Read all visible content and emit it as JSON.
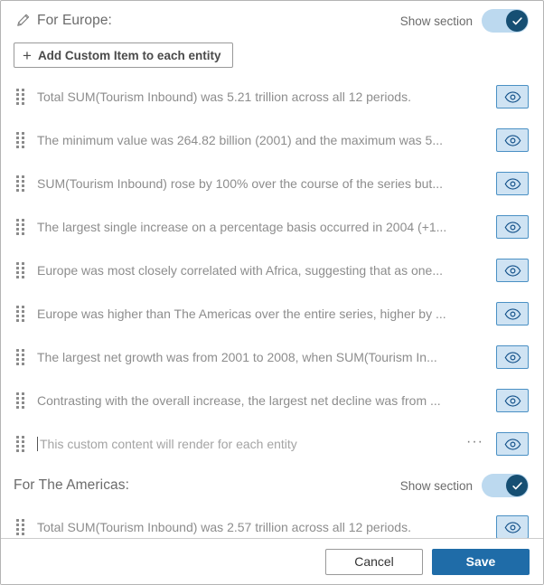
{
  "dialog": {
    "sections": [
      {
        "title": "For Europe:",
        "has_edit_icon": true,
        "edit_icon": "pencil-icon",
        "show_section_label": "Show section",
        "toggle_on": true,
        "add_button_label": "Add Custom Item to each entity",
        "add_button_icon": "plus-icon",
        "items": [
          {
            "text": "Total SUM(Tourism Inbound) was 5.21 trillion across all 12 periods.",
            "placeholder": false,
            "has_menu": false,
            "visibility_icon": "eye-icon"
          },
          {
            "text": "The minimum value was 264.82 billion (2001) and the maximum was 5...",
            "placeholder": false,
            "has_menu": false,
            "visibility_icon": "eye-icon"
          },
          {
            "text": "SUM(Tourism Inbound) rose by 100% over the course of the series but...",
            "placeholder": false,
            "has_menu": false,
            "visibility_icon": "eye-icon"
          },
          {
            "text": "The largest single increase on a percentage basis occurred in 2004 (+1...",
            "placeholder": false,
            "has_menu": false,
            "visibility_icon": "eye-icon"
          },
          {
            "text": "Europe was most closely correlated with Africa, suggesting that as one...",
            "placeholder": false,
            "has_menu": false,
            "visibility_icon": "eye-icon"
          },
          {
            "text": "Europe was higher than The Americas over the entire series, higher by ...",
            "placeholder": false,
            "has_menu": false,
            "visibility_icon": "eye-icon"
          },
          {
            "text": "The largest net growth was from 2001 to 2008, when SUM(Tourism In...",
            "placeholder": false,
            "has_menu": false,
            "visibility_icon": "eye-icon"
          },
          {
            "text": "Contrasting with the overall increase, the largest net decline was from ...",
            "placeholder": false,
            "has_menu": false,
            "visibility_icon": "eye-icon"
          },
          {
            "text": "This custom content will render for each entity",
            "placeholder": true,
            "has_menu": true,
            "menu_label": "···",
            "visibility_icon": "eye-icon"
          }
        ]
      },
      {
        "title": "For The Americas:",
        "has_edit_icon": false,
        "show_section_label": "Show section",
        "toggle_on": true,
        "items": [
          {
            "text": "Total SUM(Tourism Inbound) was 2.57 trillion across all 12 periods.",
            "placeholder": false,
            "has_menu": false,
            "visibility_icon": "eye-icon"
          }
        ]
      }
    ],
    "footer": {
      "cancel_label": "Cancel",
      "save_label": "Save"
    },
    "colors": {
      "save_button": "#1f6ca8",
      "toggle_track": "#bcd9ef",
      "toggle_knob": "#164f73",
      "eye_button_fill": "#cfe3f3",
      "eye_button_border": "#4a90c4",
      "item_text": "#8d8d8d"
    }
  }
}
